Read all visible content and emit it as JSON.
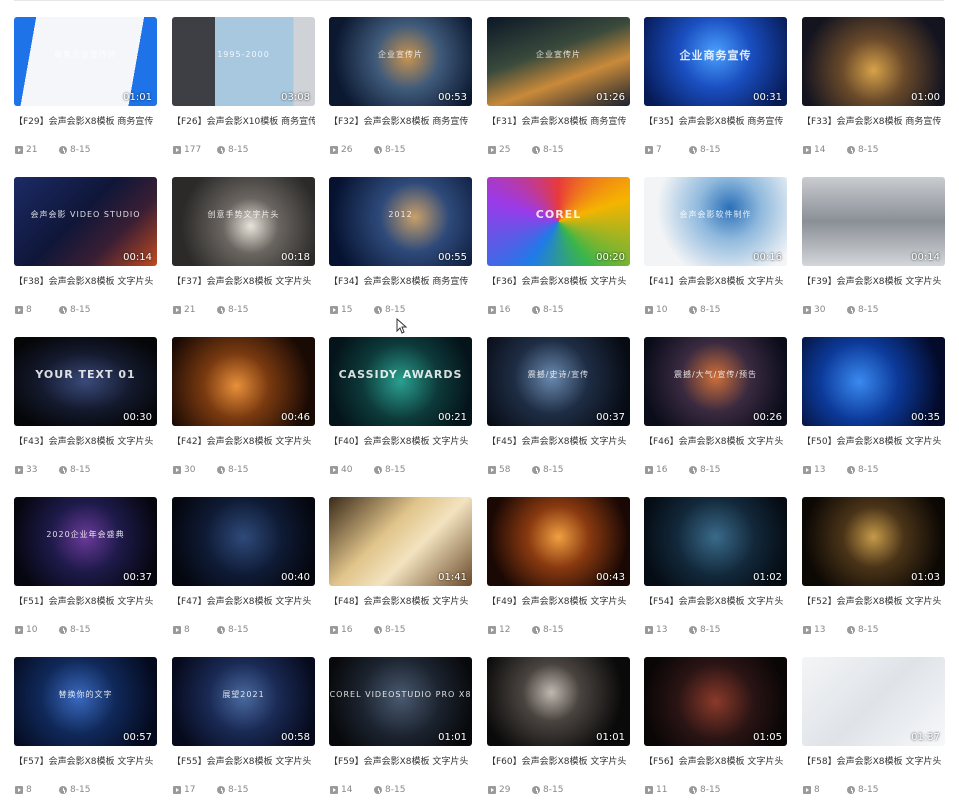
{
  "items": [
    {
      "id": "F29",
      "title": "【F29】会声会影X8模板 商务宣传",
      "duration": "01:01",
      "plays": "21",
      "date": "8-15",
      "text": "商务企业宣传片",
      "bg": "linear-gradient(100deg,#1e73e8 0 14%,#f4f6fa 14% 82%,#1e73e8 82%)"
    },
    {
      "id": "F26",
      "title": "【F26】会声会影X10模板 商务宣传",
      "duration": "03:08",
      "plays": "177",
      "date": "8-15",
      "text": "1995-2000",
      "bg": "linear-gradient(90deg,#3d3f44 0 30%,#a8c8e0 30% 85%,#cfd3d8 85%)"
    },
    {
      "id": "F32",
      "title": "【F32】会声会影X8模板 商务宣传",
      "duration": "00:53",
      "plays": "26",
      "date": "8-15",
      "text": "企业宣传片",
      "bg": "radial-gradient(circle at 55% 45%,#c99450 0%,#3f5a7a 35%,#0b1830 80%)"
    },
    {
      "id": "F31",
      "title": "【F31】会声会影X8模板 商务宣传",
      "duration": "01:26",
      "plays": "25",
      "date": "8-15",
      "text": "企业宣传片",
      "bg": "linear-gradient(160deg,#0b1726 0%,#3a4a3c 40%,#c98a3a 65%,#1a2230 100%)"
    },
    {
      "id": "F35",
      "title": "【F35】会声会影X8模板 商务宣传",
      "duration": "00:31",
      "plays": "7",
      "date": "8-15",
      "text": "企业商务宣传",
      "big": true,
      "bg": "radial-gradient(circle at 50% 40%,#4aa0ff 0%,#1a4ec0 40%,#061a55 90%)"
    },
    {
      "id": "F33",
      "title": "【F33】会声会影X8模板 商务宣传",
      "duration": "01:00",
      "plays": "14",
      "date": "8-15",
      "text": "",
      "bg": "radial-gradient(circle at 50% 60%,#d7a24a 0%,#6a4a2a 35%,#141420 80%)"
    },
    {
      "id": "F38",
      "title": "【F38】会声会影X8模板 文字片头",
      "duration": "00:14",
      "plays": "8",
      "date": "8-15",
      "text": "会声会影 VIDEO STUDIO",
      "bg": "linear-gradient(135deg,#1c2b66 0%,#0f1638 45%,#3a1e34 70%,#c04a20 100%)"
    },
    {
      "id": "F37",
      "title": "【F37】会声会影X8模板 文字片头",
      "duration": "00:18",
      "plays": "21",
      "date": "8-15",
      "text": "创意手势文字片头",
      "bg": "radial-gradient(circle at 55% 55%,#e9e4da 0%,#6a6560 30%,#2b2a29 75%)"
    },
    {
      "id": "F34",
      "title": "【F34】会声会影X8模板 商务宣传",
      "duration": "00:55",
      "plays": "15",
      "date": "8-15",
      "text": "2012",
      "bg": "radial-gradient(circle at 60% 45%,#c9a06a 0%,#2e4a7a 35%,#061230 85%)"
    },
    {
      "id": "F36",
      "title": "【F36】会声会影X8模板 文字片头",
      "duration": "00:20",
      "plays": "16",
      "date": "8-15",
      "text": "COREL",
      "big": true,
      "bg": "conic-gradient(#e83a3a,#f5b400,#3ab54a,#1e7be8,#9b3ae8,#e83a3a)"
    },
    {
      "id": "F41",
      "title": "【F41】会声会影X8模板 文字片头",
      "duration": "00:16",
      "plays": "10",
      "date": "8-15",
      "text": "会声会影软件制作",
      "bg": "radial-gradient(circle at 60% 35%,#2a6fb8 0%,#8fb9dd 30%,#f2f4f6 70%)"
    },
    {
      "id": "F39",
      "title": "【F39】会声会影X8模板 文字片头",
      "duration": "00:14",
      "plays": "30",
      "date": "8-15",
      "text": "",
      "bg": "linear-gradient(180deg,#c9ccd0 0%,#8a8f96 50%,#d3d6da 100%)"
    },
    {
      "id": "F43",
      "title": "【F43】会声会影X8模板 文字片头",
      "duration": "00:30",
      "plays": "33",
      "date": "8-15",
      "text": "YOUR TEXT 01",
      "big": true,
      "bg": "radial-gradient(ellipse at 50% 50%,#3a4a7a 0%,#141a2e 45%,#050608 85%)"
    },
    {
      "id": "F42",
      "title": "【F42】会声会影X8模板 文字片头",
      "duration": "00:46",
      "plays": "30",
      "date": "8-15",
      "text": "",
      "bg": "radial-gradient(circle at 45% 55%,#e8903a 0%,#7a3a10 35%,#1a0a04 80%)"
    },
    {
      "id": "F40",
      "title": "【F40】会声会影X8模板 文字片头",
      "duration": "00:21",
      "plays": "40",
      "date": "8-15",
      "text": "CASSIDY AWARDS",
      "big": true,
      "bg": "radial-gradient(circle at 50% 50%,#2aa090 0%,#0d3a3a 45%,#04141a 85%)"
    },
    {
      "id": "F45",
      "title": "【F45】会声会影X8模板 文字片头",
      "duration": "00:37",
      "plays": "58",
      "date": "8-15",
      "text": "震撼/史诗/宣传",
      "bg": "radial-gradient(circle at 45% 45%,#6a8ab0 0%,#1e2d44 40%,#070b14 85%)"
    },
    {
      "id": "F46",
      "title": "【F46】会声会影X8模板 文字片头",
      "duration": "00:26",
      "plays": "16",
      "date": "8-15",
      "text": "震撼/大气/宣传/预告",
      "bg": "radial-gradient(circle at 50% 45%,#d0703a 0%,#3a2a40 40%,#0a0c1a 85%)"
    },
    {
      "id": "F50",
      "title": "【F50】会声会影X8模板 文字片头",
      "duration": "00:35",
      "plays": "13",
      "date": "8-15",
      "text": "",
      "bg": "radial-gradient(circle at 40% 50%,#3a8af0 0%,#0c3a9a 40%,#030a2a 85%)"
    },
    {
      "id": "F51",
      "title": "【F51】会声会影X8模板 文字片头",
      "duration": "00:37",
      "plays": "10",
      "date": "8-15",
      "text": "2020企业年会盛典",
      "bg": "radial-gradient(circle at 50% 45%,#6a3a9a 0%,#1e1a4a 40%,#05060f 85%)"
    },
    {
      "id": "F47",
      "title": "【F47】会声会影X8模板 文字片头",
      "duration": "00:40",
      "plays": "8",
      "date": "8-15",
      "text": "",
      "bg": "radial-gradient(circle at 50% 45%,#2e4a7a 0%,#0e1a34 45%,#05070f 85%)"
    },
    {
      "id": "F48",
      "title": "【F48】会声会影X8模板 文字片头",
      "duration": "01:41",
      "plays": "16",
      "date": "8-15",
      "text": "",
      "bg": "linear-gradient(135deg,#3a2a1a 0%,#e0c48a 40%,#f3e3c0 60%,#6a4a2a 100%)"
    },
    {
      "id": "F49",
      "title": "【F49】会声会影X8模板 文字片头",
      "duration": "00:43",
      "plays": "12",
      "date": "8-15",
      "text": "",
      "bg": "radial-gradient(circle at 50% 45%,#f0a040 0%,#8a3a10 35%,#1a0804 80%)"
    },
    {
      "id": "F54",
      "title": "【F54】会声会影X8模板 文字片头",
      "duration": "01:02",
      "plays": "13",
      "date": "8-15",
      "text": "",
      "bg": "radial-gradient(circle at 50% 45%,#3a6a8a 0%,#12283a 45%,#050c14 85%)"
    },
    {
      "id": "F52",
      "title": "【F52】会声会影X8模板 文字片头",
      "duration": "01:03",
      "plays": "13",
      "date": "8-15",
      "text": "",
      "bg": "radial-gradient(circle at 50% 45%,#c69a4a 0%,#4a3418 35%,#0c0804 80%)"
    },
    {
      "id": "F57",
      "title": "【F57】会声会影X8模板 文字片头",
      "duration": "00:57",
      "plays": "8",
      "date": "8-15",
      "text": "替换你的文字",
      "bg": "radial-gradient(circle at 45% 45%,#3a6ac0 0%,#10295a 40%,#040a1e 85%)"
    },
    {
      "id": "F55",
      "title": "【F55】会声会影X8模板 文字片头",
      "duration": "00:58",
      "plays": "17",
      "date": "8-15",
      "text": "展望2021",
      "bg": "radial-gradient(circle at 50% 45%,#4a6aa0 0%,#1a2a55 40%,#060a1c 85%)"
    },
    {
      "id": "F59",
      "title": "【F59】会声会影X8模板 文字片头",
      "duration": "01:01",
      "plays": "14",
      "date": "8-15",
      "text": "COREL VIDEOSTUDIO PRO X8",
      "bg": "radial-gradient(circle at 50% 45%,#4a5a70 0%,#1c2430 45%,#08090c 85%)"
    },
    {
      "id": "F60",
      "title": "【F60】会声会影X8模板 文字片头",
      "duration": "01:01",
      "plays": "29",
      "date": "8-15",
      "text": "",
      "bg": "radial-gradient(circle at 45% 40%,#c0b8b0 0%,#4a4440 30%,#0a0a0a 75%)"
    },
    {
      "id": "F56",
      "title": "【F56】会声会影X8模板 文字片头",
      "duration": "01:05",
      "plays": "11",
      "date": "8-15",
      "text": "",
      "bg": "radial-gradient(circle at 50% 50%,#8a3a2a 0%,#2a1414 45%,#0a0606 85%)"
    },
    {
      "id": "F58",
      "title": "【F58】会声会影X8模板 文字片头",
      "duration": "01:37",
      "plays": "8",
      "date": "8-15",
      "text": "",
      "bg": "linear-gradient(135deg,#f4f5f7 0%,#dfe3e8 50%,#f7f8fa 100%)"
    }
  ]
}
